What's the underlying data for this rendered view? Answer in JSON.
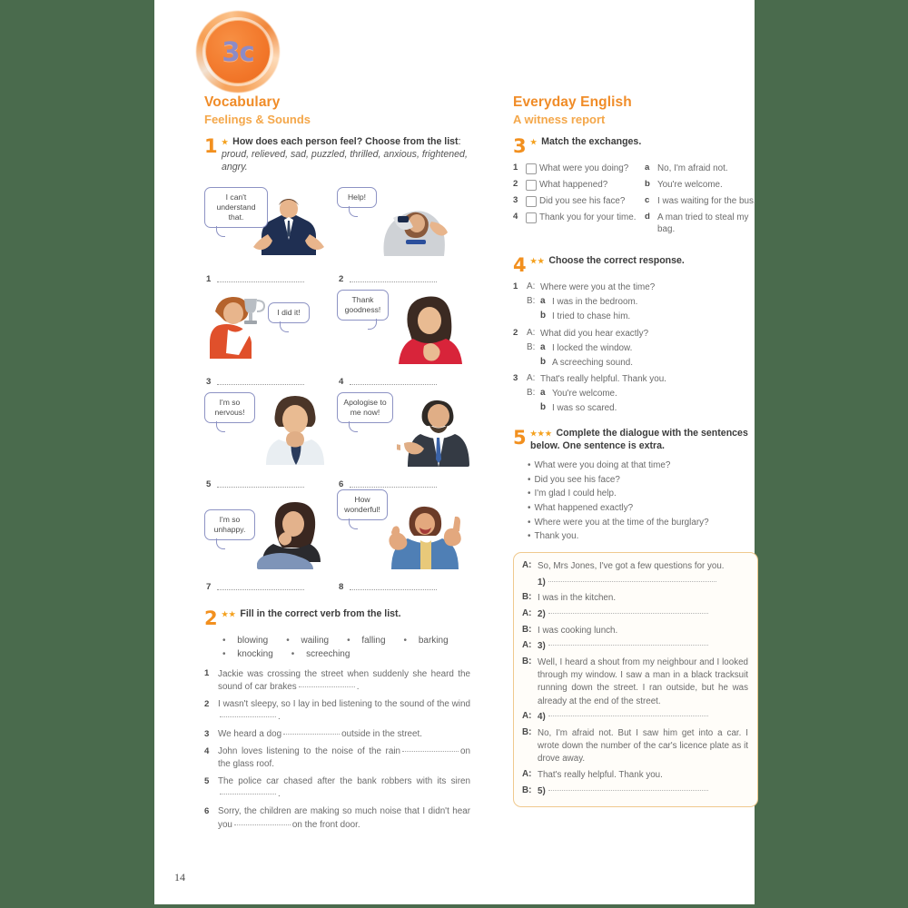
{
  "page": {
    "number": "14",
    "unit_badge": "3c",
    "background_color": "#4a6b4d",
    "accent_color": "#f08c28"
  },
  "left_column": {
    "section_title": "Vocabulary",
    "section_subtitle": "Feelings & Sounds",
    "exercise1": {
      "number": "1",
      "stars": "★",
      "title_bold": "How does each person feel? Choose from the list",
      "title_colon": ":",
      "word_list": "proud, relieved, sad, puzzled, thrilled, anxious, frightened, angry.",
      "items": [
        {
          "n": "1",
          "bubble": "I can't understand that.",
          "bubble_side": "left",
          "answer": ""
        },
        {
          "n": "2",
          "bubble": "Help!",
          "bubble_side": "left",
          "answer": ""
        },
        {
          "n": "3",
          "bubble": "I did it!",
          "bubble_side": "right",
          "answer": ""
        },
        {
          "n": "4",
          "bubble": "Thank goodness!",
          "bubble_side": "left",
          "answer": ""
        },
        {
          "n": "5",
          "bubble": "I'm so nervous!",
          "bubble_side": "left",
          "answer": ""
        },
        {
          "n": "6",
          "bubble": "Apologise to me now!",
          "bubble_side": "left",
          "answer": ""
        },
        {
          "n": "7",
          "bubble": "I'm so unhappy.",
          "bubble_side": "left",
          "answer": ""
        },
        {
          "n": "8",
          "bubble": "How wonderful!",
          "bubble_side": "left",
          "answer": ""
        }
      ]
    },
    "exercise2": {
      "number": "2",
      "stars": "★★",
      "title": "Fill in the correct verb from the list.",
      "words": [
        "blowing",
        "wailing",
        "falling",
        "barking",
        "knocking",
        "screeching"
      ],
      "questions": [
        {
          "n": "1",
          "pre": "Jackie was crossing the street when suddenly she heard the sound of car brakes",
          "post": "."
        },
        {
          "n": "2",
          "pre": "I wasn't sleepy, so I lay in bed listening to the sound of the wind",
          "post": "."
        },
        {
          "n": "3",
          "pre": "We heard a dog",
          "post": "outside in the street."
        },
        {
          "n": "4",
          "pre": "John loves listening to the noise of the rain",
          "post": "on the glass roof."
        },
        {
          "n": "5",
          "pre": "The police car chased after the bank robbers with its siren",
          "post": "."
        },
        {
          "n": "6",
          "pre": "Sorry, the children are making so much noise that I didn't hear you",
          "post": "on the front door."
        }
      ]
    }
  },
  "right_column": {
    "section_title": "Everyday English",
    "section_subtitle": "A witness report",
    "exercise3": {
      "number": "3",
      "stars": "★",
      "title": "Match the exchanges.",
      "left_items": [
        {
          "n": "1",
          "text": "What were you doing?"
        },
        {
          "n": "2",
          "text": "What happened?"
        },
        {
          "n": "3",
          "text": "Did you see his face?"
        },
        {
          "n": "4",
          "text": "Thank you for your time."
        }
      ],
      "right_items": [
        {
          "l": "a",
          "text": "No, I'm afraid not."
        },
        {
          "l": "b",
          "text": "You're welcome."
        },
        {
          "l": "c",
          "text": "I was waiting for the bus."
        },
        {
          "l": "d",
          "text": "A man tried to steal my bag."
        }
      ]
    },
    "exercise4": {
      "number": "4",
      "stars": "★★",
      "title": "Choose the correct response.",
      "groups": [
        {
          "n": "1",
          "a_speaker": "A:",
          "a_text": "Where were you at the time?",
          "b_speaker": "B:",
          "options": [
            {
              "label": "a",
              "text": "I was in the bedroom."
            },
            {
              "label": "b",
              "text": "I tried to chase him."
            }
          ]
        },
        {
          "n": "2",
          "a_speaker": "A:",
          "a_text": "What did you hear exactly?",
          "b_speaker": "B:",
          "options": [
            {
              "label": "a",
              "text": "I locked the window."
            },
            {
              "label": "b",
              "text": "A screeching sound."
            }
          ]
        },
        {
          "n": "3",
          "a_speaker": "A:",
          "a_text": "That's really helpful. Thank you.",
          "b_speaker": "B:",
          "options": [
            {
              "label": "a",
              "text": "You're welcome."
            },
            {
              "label": "b",
              "text": "I was so scared."
            }
          ]
        }
      ]
    },
    "exercise5": {
      "number": "5",
      "stars": "★★★",
      "title": "Complete the dialogue with the sentences below. One sentence is extra.",
      "bullets": [
        "What were you doing at that time?",
        "Did you see his face?",
        "I'm glad I could help.",
        "What happened exactly?",
        "Where were you at the time of the burglary?",
        "Thank you."
      ],
      "dialogue": [
        {
          "speaker": "A:",
          "text": "So, Mrs Jones, I've got a few questions for you.",
          "blank": ""
        },
        {
          "speaker": "",
          "text": "",
          "blank": "1)"
        },
        {
          "speaker": "B:",
          "text": "I was in the kitchen.",
          "blank": ""
        },
        {
          "speaker": "A:",
          "text": "",
          "blank": "2)"
        },
        {
          "speaker": "B:",
          "text": "I was cooking lunch.",
          "blank": ""
        },
        {
          "speaker": "A:",
          "text": "",
          "blank": "3)"
        },
        {
          "speaker": "B:",
          "text": "Well, I heard a shout from my neighbour and I looked through my window. I saw a man in a black tracksuit running down the street. I ran outside, but he was already at the end of the street.",
          "blank": ""
        },
        {
          "speaker": "A:",
          "text": "",
          "blank": "4)"
        },
        {
          "speaker": "B:",
          "text": "No, I'm afraid not. But I saw him get into a car. I wrote down the number of the car's licence plate as it drove away.",
          "blank": ""
        },
        {
          "speaker": "A:",
          "text": "That's really helpful. Thank you.",
          "blank": ""
        },
        {
          "speaker": "B:",
          "text": "",
          "blank": "5)"
        }
      ]
    }
  }
}
